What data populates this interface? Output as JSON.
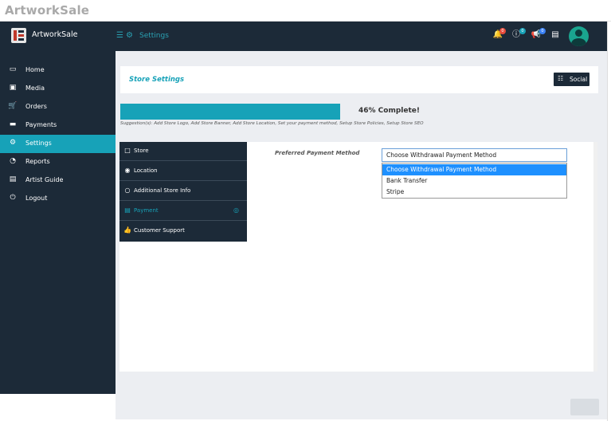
{
  "site": {
    "title": "ArtworkSale"
  },
  "topnav": {
    "brand": "ArtworkSale",
    "breadcrumb": "Settings",
    "notifications_badge": "0",
    "help_badge": "0",
    "announcements_badge": "0"
  },
  "sidebar": {
    "items": [
      {
        "label": "Home",
        "icon": "monitor-icon"
      },
      {
        "label": "Media",
        "icon": "image-icon"
      },
      {
        "label": "Orders",
        "icon": "cart-icon"
      },
      {
        "label": "Payments",
        "icon": "credit-card-icon"
      },
      {
        "label": "Settings",
        "icon": "gears-icon",
        "active": true
      },
      {
        "label": "Reports",
        "icon": "pie-chart-icon"
      },
      {
        "label": "Artist Guide",
        "icon": "book-icon"
      },
      {
        "label": "Logout",
        "icon": "power-icon"
      }
    ]
  },
  "header": {
    "title": "Store Settings",
    "social_button": "Social"
  },
  "progress": {
    "percent": 46,
    "label": "46% Complete!",
    "suggestion": "Suggestion(s): Add Store Logo, Add Store Banner, Add Store Location, Set your payment method, Setup Store Policies, Setup Store SEO"
  },
  "tabs": [
    {
      "label": "Store",
      "icon": "store-icon"
    },
    {
      "label": "Location",
      "icon": "globe-icon"
    },
    {
      "label": "Additional Store Info",
      "icon": "circle-icon"
    },
    {
      "label": "Payment",
      "icon": "money-icon",
      "active": true
    },
    {
      "label": "Customer Support",
      "icon": "thumbs-up-icon"
    }
  ],
  "payment": {
    "field_label": "Preferred Payment Method",
    "selected": "Choose Withdrawal Payment Method",
    "options": [
      "Choose Withdrawal Payment Method",
      "Bank Transfer",
      "Stripe"
    ]
  },
  "colors": {
    "navy": "#1c2a38",
    "accent": "#17a2b8",
    "selection": "#1e90ff"
  }
}
